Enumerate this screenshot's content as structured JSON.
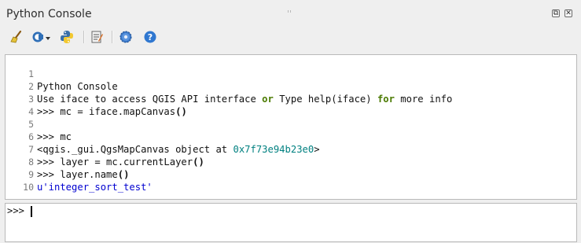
{
  "panel": {
    "title": "Python Console",
    "float_glyph": "⧉",
    "close_glyph": "✕"
  },
  "toolbar": {
    "buttons": [
      {
        "name": "clear-console-button",
        "icon": "broom-icon"
      },
      {
        "name": "import-class-button",
        "icon": "class-dropdown-icon"
      },
      {
        "name": "run-command-button",
        "icon": "python-icon"
      },
      {
        "name": "show-editor-button",
        "icon": "notepad-icon"
      },
      {
        "name": "settings-button",
        "icon": "gear-icon"
      },
      {
        "name": "help-button",
        "icon": "help-icon"
      }
    ]
  },
  "output": {
    "lines": [
      {
        "n": "1",
        "text": "Python Console"
      },
      {
        "n": "2",
        "a": "Use iface to access QGIS API interface ",
        "k1": "or",
        "b": " Type help(iface) ",
        "k2": "for",
        "c": " more info"
      },
      {
        "n": "3",
        "a": ">>> mc = iface.mapCanvas",
        "p": "()"
      },
      {
        "n": "4",
        "text": ""
      },
      {
        "n": "5",
        "text": ">>> mc"
      },
      {
        "n": "6",
        "a": "<qgis._gui.QgsMapCanvas object at ",
        "hex": "0x7f73e94b23e0",
        "c": ">"
      },
      {
        "n": "7",
        "a": ">>> layer = mc.currentLayer",
        "p": "()"
      },
      {
        "n": "8",
        "a": ">>> layer.name",
        "p": "()"
      },
      {
        "n": "9",
        "str": "u'integer_sort_test'"
      },
      {
        "n": "10",
        "text": ""
      }
    ]
  },
  "input": {
    "prompt": ">>>",
    "value": ""
  },
  "colors": {
    "keyword": "#4a7a00",
    "hex_number": "#008080",
    "string": "#0000d0"
  }
}
